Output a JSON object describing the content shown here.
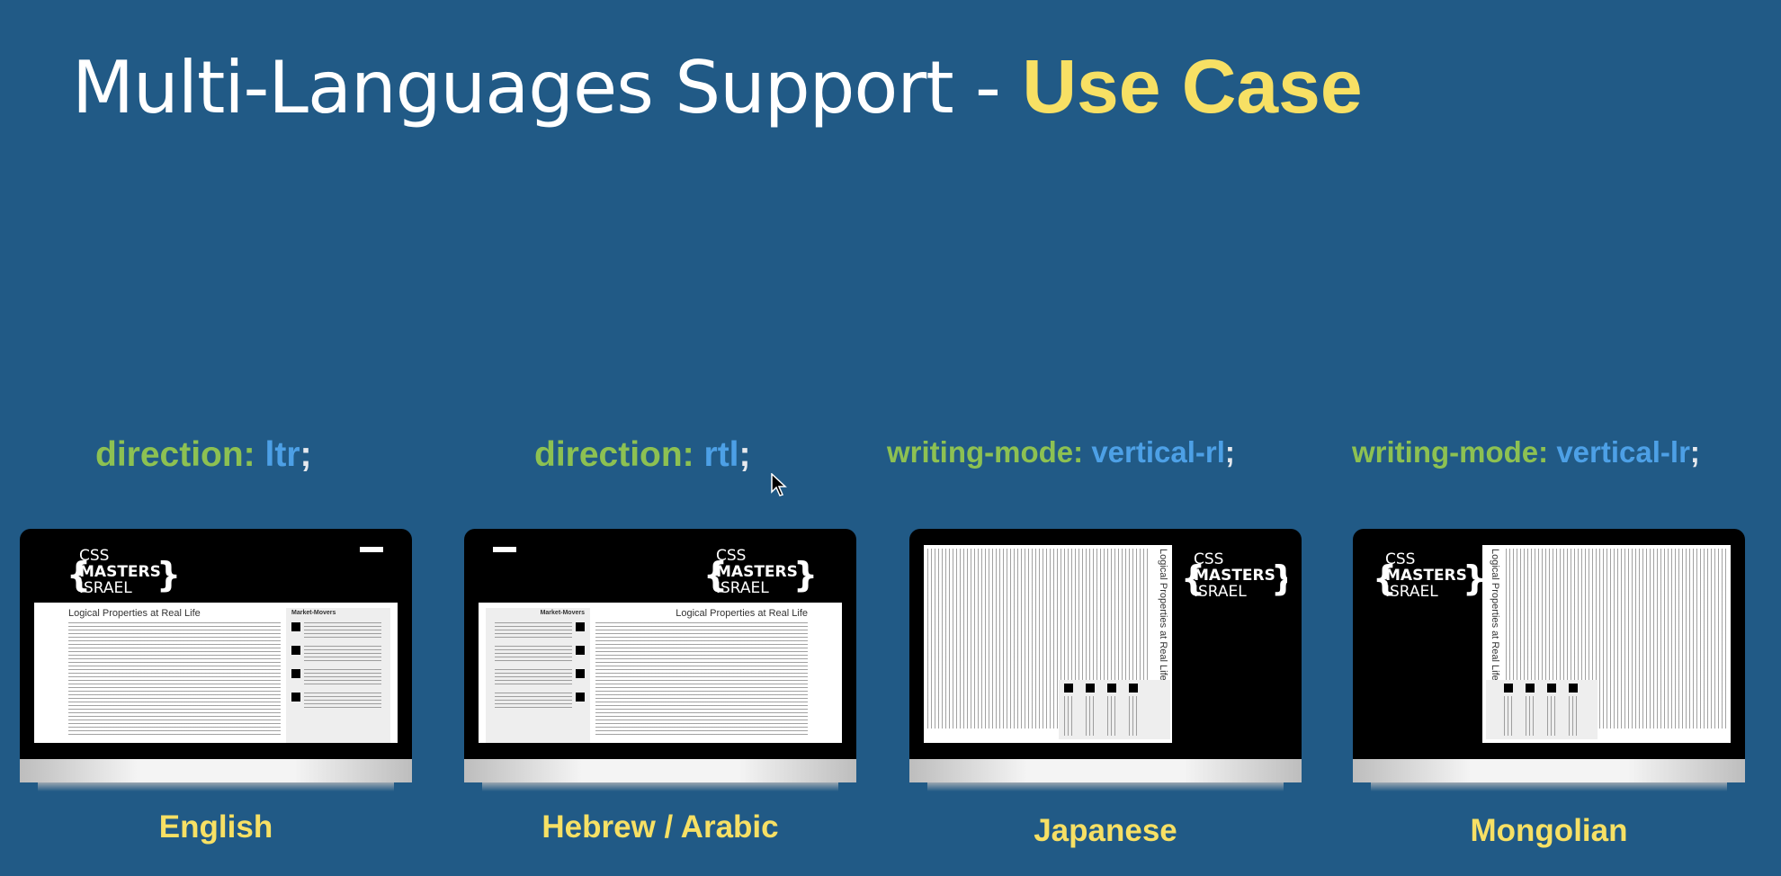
{
  "slide": {
    "title_main": "Multi-Languages Support - ",
    "title_accent": "Use Case"
  },
  "examples": [
    {
      "prop": "direction:",
      "value": "ltr",
      "semi": ";",
      "caption": "English",
      "screen": {
        "logo": [
          "CSS",
          "MASTERS",
          "ISRAEL"
        ],
        "heading": "Logical Properties at Real Life",
        "sidebar_title": "Market-Movers"
      }
    },
    {
      "prop": "direction:",
      "value": "rtl",
      "semi": ";",
      "caption": "Hebrew / Arabic",
      "screen": {
        "logo": [
          "CSS",
          "MASTERS",
          "ISRAEL"
        ],
        "heading": "Logical Properties at Real Life",
        "sidebar_title": "Market-Movers"
      }
    },
    {
      "prop": "writing-mode:",
      "value": "vertical-rl",
      "semi": ";",
      "caption": "Japanese",
      "screen": {
        "logo": [
          "CSS",
          "MASTERS",
          "ISRAEL"
        ],
        "heading": "Logical Properties at Real Life"
      }
    },
    {
      "prop": "writing-mode:",
      "value": "vertical-lr",
      "semi": ";",
      "caption": "Mongolian",
      "screen": {
        "logo": [
          "CSS",
          "MASTERS",
          "ISRAEL"
        ],
        "heading": "Logical Properties at Real Life"
      }
    }
  ],
  "colors": {
    "background": "#215a86",
    "accent": "#f7e064",
    "property": "#8dc152",
    "value": "#4da0e6"
  },
  "icons": {
    "cursor": "mouse-pointer-icon"
  }
}
